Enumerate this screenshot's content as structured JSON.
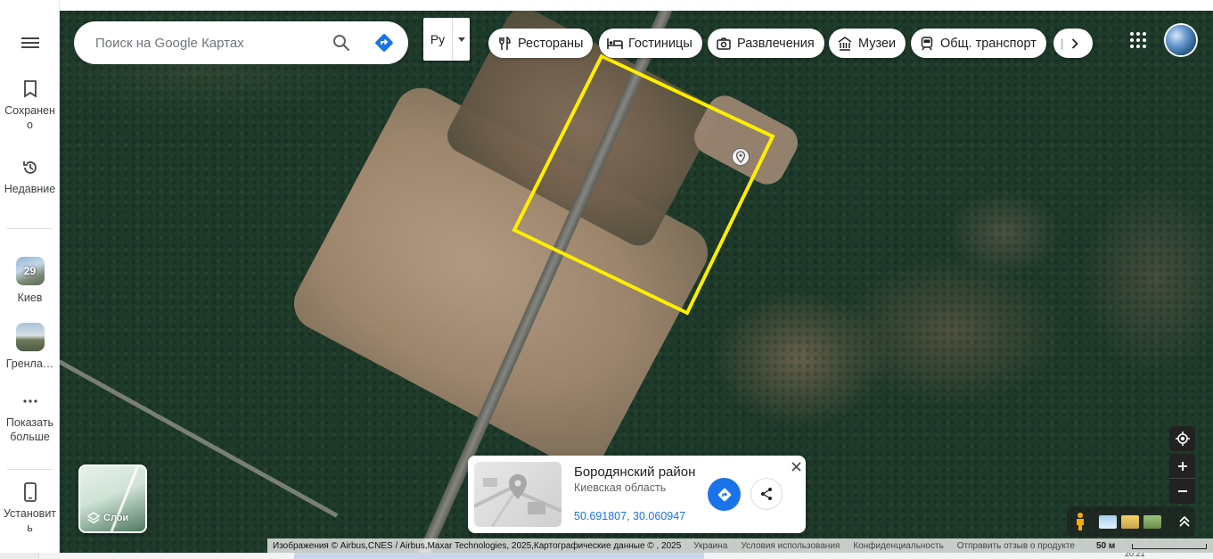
{
  "sidebar": {
    "menu_icon": "hamburger-menu-icon",
    "items": [
      {
        "label": "Сохранено",
        "icon": "bookmark-icon"
      },
      {
        "label": "Недавние",
        "icon": "history-icon"
      },
      {
        "label": "Киев",
        "badge": "29"
      },
      {
        "label": "Гренла…"
      },
      {
        "label": "Показать больше",
        "icon": "more-horizontal-icon"
      },
      {
        "label": "Установить",
        "icon": "phone-icon"
      }
    ]
  },
  "search": {
    "placeholder": "Поиск на Google Картах",
    "lang_value": "Ру"
  },
  "chips": [
    {
      "label": "Рестораны",
      "icon": "restaurant-icon"
    },
    {
      "label": "Гостиницы",
      "icon": "hotel-bed-icon"
    },
    {
      "label": "Развлечения",
      "icon": "camera-icon"
    },
    {
      "label": "Музеи",
      "icon": "museum-icon"
    },
    {
      "label": "Общ. транспорт",
      "icon": "train-icon"
    }
  ],
  "place_card": {
    "title": "Бородянский район",
    "subtitle": "Киевская область",
    "coords": "50.691807, 30.060947"
  },
  "layers": {
    "label": "Слои"
  },
  "footer": {
    "attribution": "Изображения © Airbus,CNES / Airbus,Maxar Technologies, 2025,Картографические данные © , 2025",
    "links": [
      "Украина",
      "Условия использования",
      "Конфиденциальность",
      "Отправить отзыв о продукте"
    ],
    "scale": "50 м"
  },
  "taskbar": {
    "time": "20:21"
  },
  "colors": {
    "accent": "#1a73e8",
    "highlight": "#ffee00"
  }
}
